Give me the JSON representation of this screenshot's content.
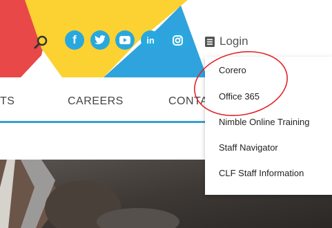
{
  "header": {
    "login_label": "Login",
    "colors": {
      "red": "#e84848",
      "yellow": "#fbd231",
      "blue": "#2ea3dd",
      "social": "#29a8df"
    },
    "social_links": [
      {
        "name": "facebook-icon",
        "glyph": "f"
      },
      {
        "name": "twitter-icon",
        "glyph": ""
      },
      {
        "name": "youtube-icon",
        "glyph": ""
      },
      {
        "name": "linkedin-icon",
        "glyph": "in"
      },
      {
        "name": "instagram-icon",
        "glyph": ""
      }
    ]
  },
  "nav": {
    "items": [
      {
        "label": "TS"
      },
      {
        "label": "CAREERS"
      },
      {
        "label": "CONTA"
      }
    ],
    "accent_color": "#3a9fce"
  },
  "login_menu": {
    "items": [
      {
        "label": "Corero"
      },
      {
        "label": "Office 365"
      },
      {
        "label": "Nimble Online Training"
      },
      {
        "label": "Staff Navigator"
      },
      {
        "label": "CLF Staff Information"
      }
    ]
  },
  "annotation": {
    "color": "#e0242a"
  }
}
